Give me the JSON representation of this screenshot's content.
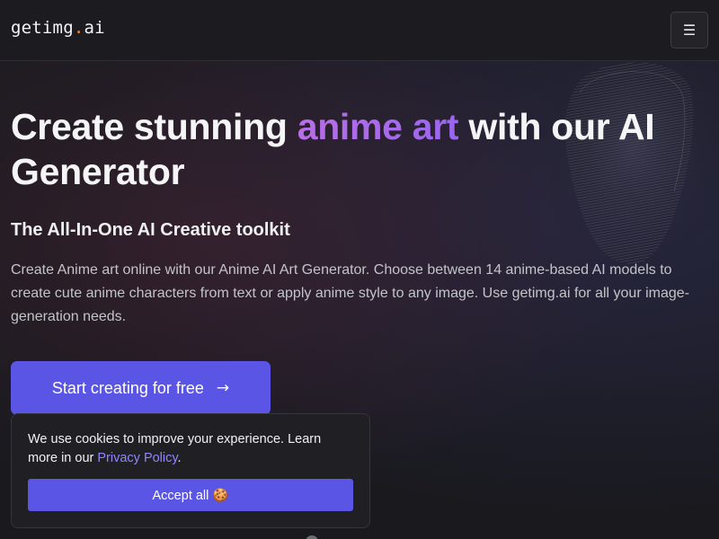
{
  "header": {
    "logo_prefix": "getimg",
    "logo_dot": ".",
    "logo_suffix": "ai",
    "menu_icon": "☰"
  },
  "hero": {
    "title_part1": "Create stunning ",
    "title_accent": "anime art",
    "title_part2": " with our AI Generator",
    "subtitle": "The All-In-One AI Creative toolkit",
    "description": "Create Anime art online with our Anime AI Art Generator. Choose between 14 anime-based AI models to create cute anime characters from text or apply anime style to any image. Use getimg.ai for all your image-generation needs.",
    "cta_label": "Start creating for free",
    "cta_arrow": "→"
  },
  "cookie_banner": {
    "text": "We use cookies to improve your experience. Learn more in our ",
    "link_text": "Privacy Policy",
    "text_end": ".",
    "accept_label": "Accept all 🍪"
  },
  "colors": {
    "accent": "#5b55e6",
    "logo_dot": "#f08a3c",
    "title_gradient_start": "#b86ee6",
    "link": "#8e86ff"
  },
  "icons": {
    "menu": "hamburger-menu-icon",
    "cta": "arrow-right-icon"
  }
}
